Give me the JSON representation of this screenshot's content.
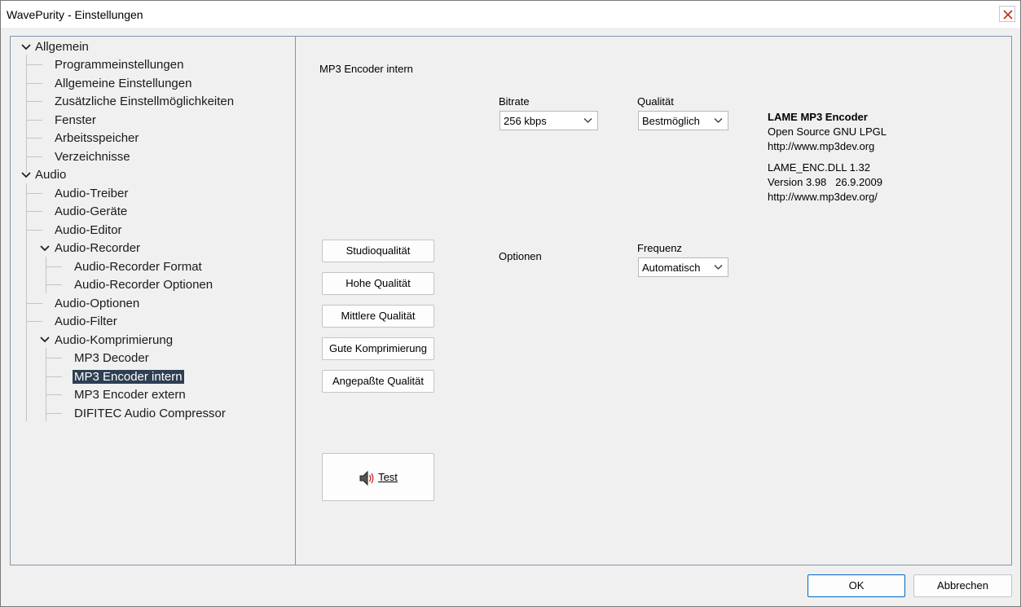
{
  "window": {
    "title": "WavePurity - Einstellungen"
  },
  "tree": {
    "items": [
      {
        "label": "Allgemein"
      },
      {
        "label": "Programmeinstellungen"
      },
      {
        "label": "Allgemeine Einstellungen"
      },
      {
        "label": "Zusätzliche Einstellmöglichkeiten"
      },
      {
        "label": "Fenster"
      },
      {
        "label": "Arbeitsspeicher"
      },
      {
        "label": "Verzeichnisse"
      },
      {
        "label": "Audio"
      },
      {
        "label": "Audio-Treiber"
      },
      {
        "label": "Audio-Geräte"
      },
      {
        "label": "Audio-Editor"
      },
      {
        "label": "Audio-Recorder"
      },
      {
        "label": "Audio-Recorder Format"
      },
      {
        "label": "Audio-Recorder Optionen"
      },
      {
        "label": "Audio-Optionen"
      },
      {
        "label": "Audio-Filter"
      },
      {
        "label": "Audio-Komprimierung"
      },
      {
        "label": "MP3 Decoder"
      },
      {
        "label": "MP3 Encoder intern"
      },
      {
        "label": "MP3 Encoder extern"
      },
      {
        "label": "DIFITEC Audio Compressor"
      }
    ],
    "selected": "MP3 Encoder intern"
  },
  "content": {
    "section_title": "MP3 Encoder intern",
    "bitrate": {
      "label": "Bitrate",
      "value": "256 kbps"
    },
    "qualitaet": {
      "label": "Qualität",
      "value": "Bestmöglich"
    },
    "optionen_label": "Optionen",
    "frequenz": {
      "label": "Frequenz",
      "value": "Automatisch"
    },
    "info": {
      "title": "LAME MP3 Encoder",
      "line1": "Open Source GNU LPGL",
      "line2": "http://www.mp3dev.org",
      "line3": "LAME_ENC.DLL 1.32",
      "line4": "Version 3.98   26.9.2009",
      "line5": "http://www.mp3dev.org/"
    },
    "preset_buttons": [
      {
        "label": "Studioqualität"
      },
      {
        "label": "Hohe Qualität"
      },
      {
        "label": "Mittlere Qualität"
      },
      {
        "label": "Gute Komprimierung"
      },
      {
        "label": "Angepaßte Qualität"
      }
    ],
    "test_button": {
      "label": "Test",
      "icon": "speaker-icon"
    }
  },
  "footer": {
    "ok_label": "OK",
    "cancel_label": "Abbrechen"
  },
  "colors": {
    "selection": "#2e3f54",
    "panel_border": "#8095ad",
    "ok_border": "#0067c0"
  }
}
